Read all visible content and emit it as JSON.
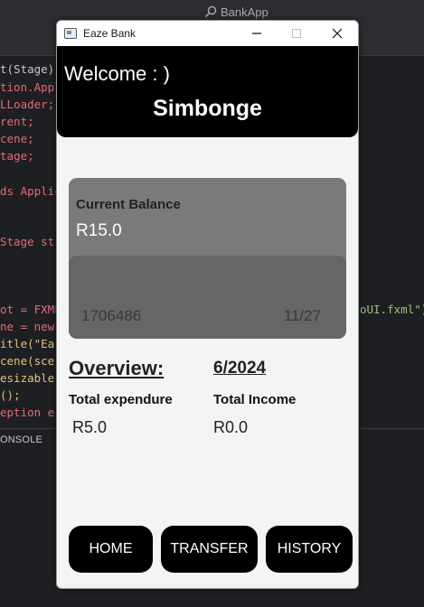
{
  "ide": {
    "title": "BankApp",
    "panel_tab": "ONSOLE",
    "code_left": [
      {
        "text": "t(Stage)",
        "color": "#c8c8c8"
      },
      {
        "text": "tion.Appli",
        "color": "#e06c75"
      },
      {
        "text": "LLoader;",
        "color": "#e06c75"
      },
      {
        "text": "rent;",
        "color": "#e06c75"
      },
      {
        "text": "cene;",
        "color": "#e06c75"
      },
      {
        "text": "tage;",
        "color": "#e06c75"
      },
      {
        "text": "ds Applic",
        "color": "#e06c75"
      },
      {
        "text": "Stage st",
        "color": "#e06c75"
      },
      {
        "text": "ot = FXMLL",
        "color": "#e06c75"
      },
      {
        "text": "ne = new",
        "color": "#e06c75"
      },
      {
        "text": "itle(\"Ea",
        "color": "#e5c07b"
      },
      {
        "text": "cene(sce",
        "color": "#e5c07b"
      },
      {
        "text": "esizable",
        "color": "#e5c07b"
      },
      {
        "text": "();",
        "color": "#e5c07b"
      },
      {
        "text": "eption e)",
        "color": "#e06c75"
      }
    ],
    "code_right": "oUI.fxml\")"
  },
  "window": {
    "title": "Eaze Bank"
  },
  "header": {
    "welcome": "Welcome : )",
    "username": "Simbonge"
  },
  "card": {
    "balance_label": "Current Balance",
    "balance_value": "R15.0",
    "card_number": "1706486",
    "expiry": "11/27"
  },
  "overview": {
    "title": "Overview:",
    "period": "6/2024",
    "expenditure_label": "Total expendure",
    "expenditure_value": "R5.0",
    "income_label": "Total Income",
    "income_value": "R0.0"
  },
  "nav": {
    "home": "HOME",
    "transfer": "TRANSFER",
    "history": "HISTORY"
  },
  "colors": {
    "header_bg": "#000000",
    "card_bg": "#7a7a7a",
    "card_lower_bg": "#666666",
    "window_bg": "#f4f4f4",
    "button_bg": "#000000"
  }
}
